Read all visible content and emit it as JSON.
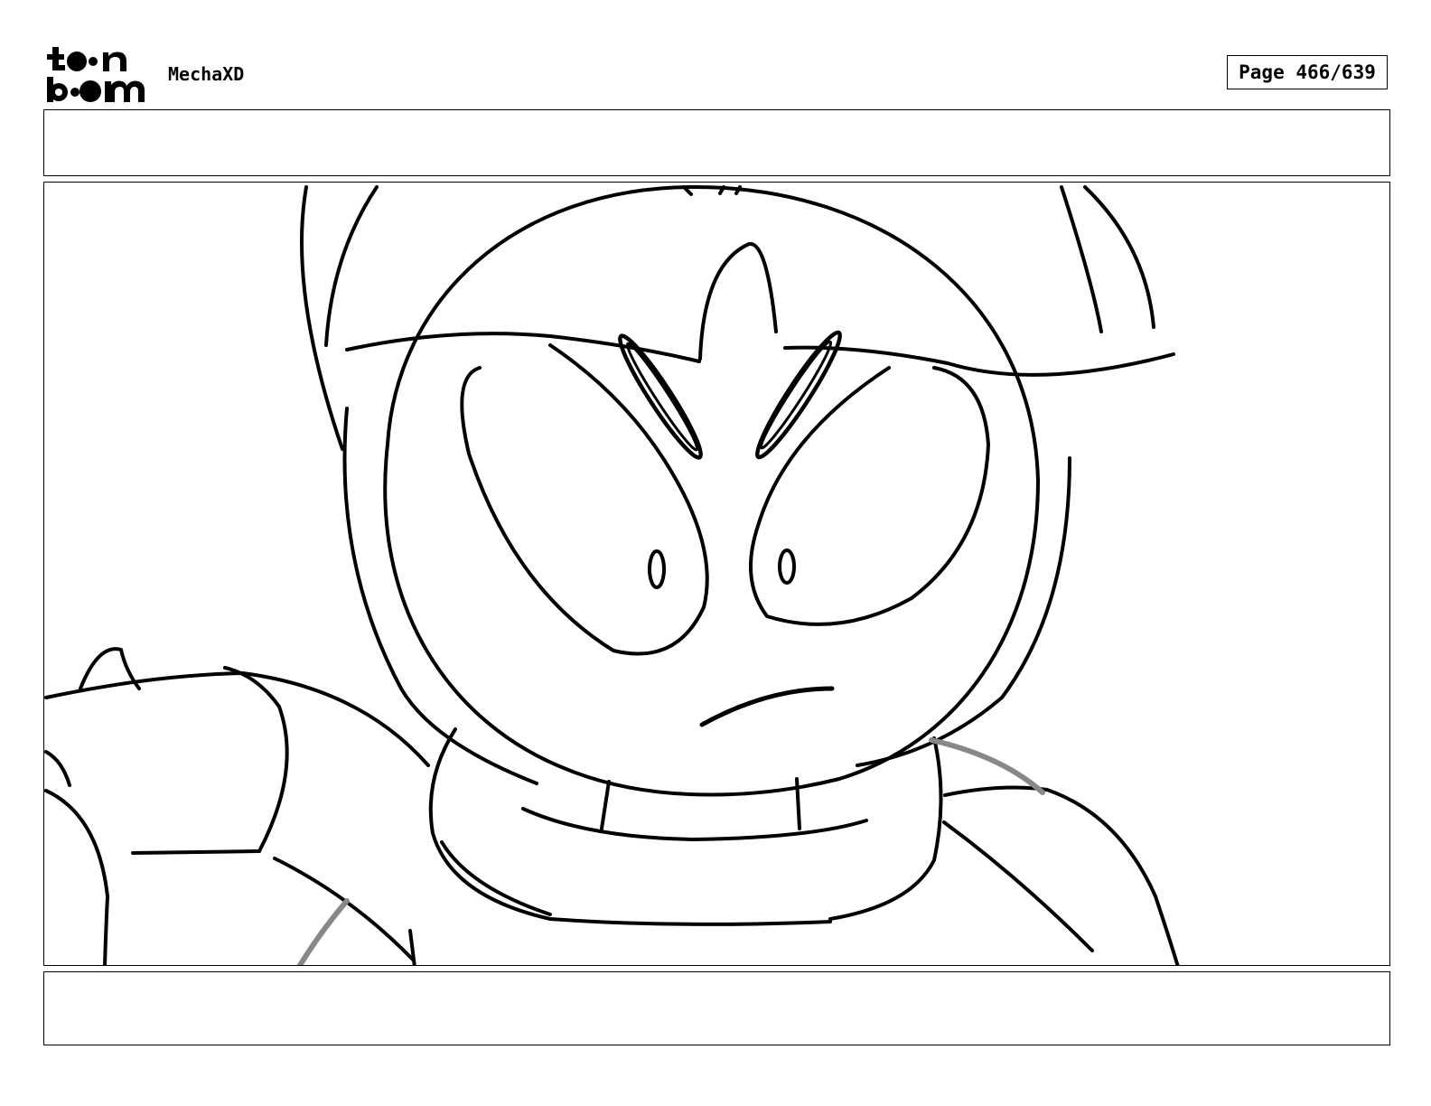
{
  "header": {
    "logo_name": "toon boom",
    "project_title": "MechaXD",
    "page_label": "Page 466/639"
  },
  "captions": {
    "top_text": "",
    "bottom_text": ""
  },
  "panel": {
    "description_icon": "storyboard-sketch"
  }
}
